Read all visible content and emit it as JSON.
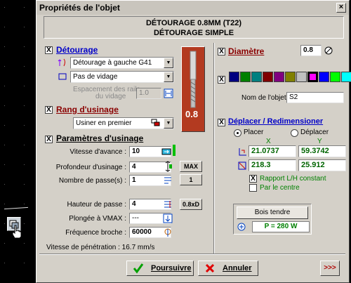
{
  "dialog": {
    "title": "Propriétés de l'objet",
    "close": "×",
    "header_line1": "DÉTOURAGE 0.8MM   (T22)",
    "header_line2": "DÉTOURAGE SIMPLE"
  },
  "detourage": {
    "title": "Détourage",
    "checked": "X",
    "mode_value": "Détourage à gauche G41",
    "vidage_value": "Pas de vidage",
    "espacement_label_1": "Espacement des rails",
    "espacement_label_2": "du vidage",
    "espacement_value": "1.0"
  },
  "tool": {
    "diameter_display": "0.8"
  },
  "diametre": {
    "title": "Diamètre",
    "checked": "X",
    "value": "0.8"
  },
  "colors": {
    "checked": "X",
    "swatches": [
      "#000080",
      "#008000",
      "#008080",
      "#800000",
      "#800080",
      "#808000",
      "#c0c0c0",
      "#ff00ff",
      "#0000ff",
      "#00ff00",
      "#00ffff"
    ],
    "selected": "#ff00ff"
  },
  "nom": {
    "label": "Nom de l'objet :",
    "value": "S2"
  },
  "rang": {
    "title": "Rang d'usinage",
    "checked": "X",
    "value": "Usiner en premier"
  },
  "params": {
    "title": "Paramètres d'usinage",
    "checked": "X",
    "vitesse_label": "Vitesse d'avance :",
    "vitesse_value": "10",
    "profondeur_label": "Profondeur d'usinage :",
    "profondeur_value": "4",
    "max_btn": "MAX",
    "passes_label": "Nombre de passe(s) :",
    "passes_value": "1",
    "passes_btn": "1",
    "hauteur_label": "Hauteur de passe :",
    "hauteur_value": "4",
    "hauteur_btn": "0.8xD",
    "plongee_label": "Plongée à VMAX :",
    "plongee_value": "---",
    "frequence_label": "Fréquence broche :",
    "frequence_value": "60000",
    "penetration_text": "Vitesse de pénétration : 16.7 mm/s"
  },
  "deplacer": {
    "title": "Déplacer / Redimensioner",
    "checked": "X",
    "placer": "Placer",
    "deplacer": "Déplacer",
    "col_x": "X",
    "col_y": "Y",
    "pos_x": "21.0737",
    "pos_y": "59.3742",
    "size_x": "218.3",
    "size_y": "25.912",
    "rapport_label": "Rapport L/H constant",
    "rapport_checked": "X",
    "centre_label": "Par le centre"
  },
  "material": {
    "label": "Bois tendre",
    "power": "P = 280 W"
  },
  "footer": {
    "ok": "Poursuivre",
    "cancel": "Annuler",
    "more": ">>>"
  }
}
